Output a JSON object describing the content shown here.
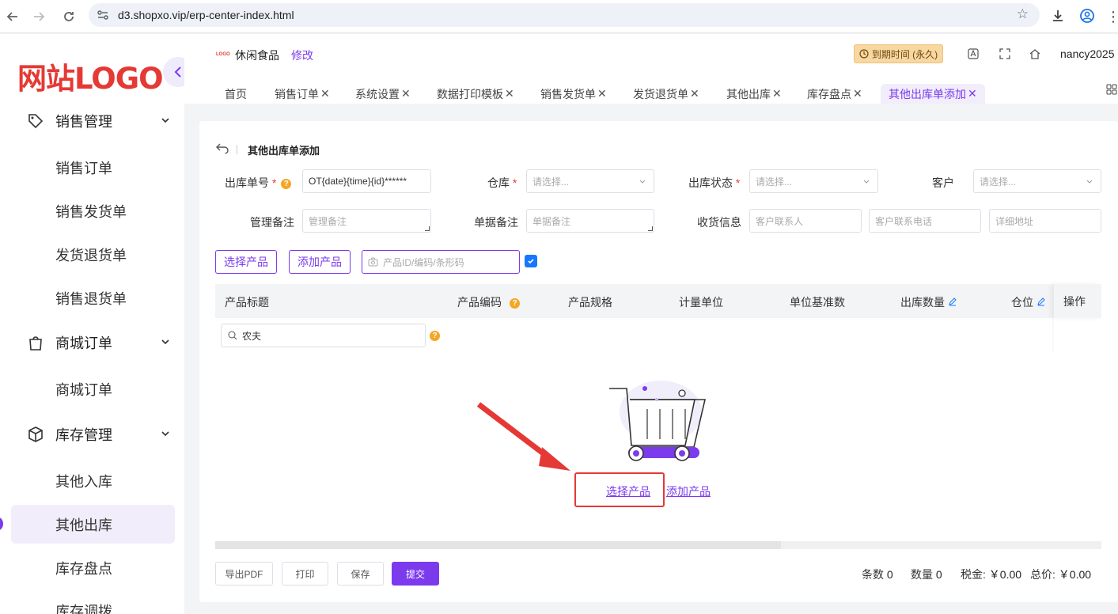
{
  "browser": {
    "url": "d3.shopxo.vip/erp-center-index.html"
  },
  "sidebar": {
    "logo": "网站LOGO",
    "groups": [
      {
        "label": "销售管理",
        "items": [
          "销售订单",
          "销售发货单",
          "发货退货单",
          "销售退货单"
        ]
      },
      {
        "label": "商城订单",
        "items": [
          "商城订单"
        ]
      },
      {
        "label": "库存管理",
        "items": [
          "其他入库",
          "其他出库",
          "库存盘点",
          "库存调拨"
        ]
      }
    ],
    "active_item": "其他出库"
  },
  "header": {
    "shop_logo": "LOGO",
    "shop_name": "休闲食品",
    "edit": "修改",
    "expire": "到期时间 (永久)",
    "user": "nancy2025"
  },
  "tabs": [
    "首页",
    "销售订单",
    "系统设置",
    "数据打印模板",
    "销售发货单",
    "发货退货单",
    "其他出库",
    "库存盘点",
    "其他出库单添加"
  ],
  "page": {
    "title": "其他出库单添加",
    "form": {
      "order_no_label": "出库单号",
      "order_no_value": "OT{date}{time}{id}******",
      "warehouse_label": "仓库",
      "warehouse_placeholder": "请选择...",
      "status_label": "出库状态",
      "status_placeholder": "请选择...",
      "customer_label": "客户",
      "customer_placeholder": "请选择...",
      "admin_note_label": "管理备注",
      "admin_note_placeholder": "管理备注",
      "doc_note_label": "单据备注",
      "doc_note_placeholder": "单据备注",
      "receive_label": "收货信息",
      "contact_placeholder": "客户联系人",
      "phone_placeholder": "客户联系电话",
      "address_placeholder": "详细地址"
    },
    "toolbar": {
      "select_product": "选择产品",
      "add_product": "添加产品",
      "search_placeholder": "产品ID/编码/条形码"
    },
    "table": {
      "headers": [
        "产品标题",
        "产品编码",
        "产品规格",
        "计量单位",
        "单位基准数",
        "出库数量",
        "仓位",
        "操作"
      ],
      "filter_value": "农夫"
    },
    "empty": {
      "select_product": "选择产品",
      "add_product": "添加产品"
    },
    "footer": {
      "export_pdf": "导出PDF",
      "print": "打印",
      "save": "保存",
      "submit": "提交",
      "count_label": "条数",
      "count_value": "0",
      "qty_label": "数量",
      "qty_value": "0",
      "tax_label": "税金:",
      "tax_value": "￥0.00",
      "total_label": "总价:",
      "total_value": "￥0.00"
    }
  },
  "colors": {
    "accent": "#7c3aed",
    "logo_red": "#e53935",
    "checkbox_blue": "#1677ff"
  }
}
